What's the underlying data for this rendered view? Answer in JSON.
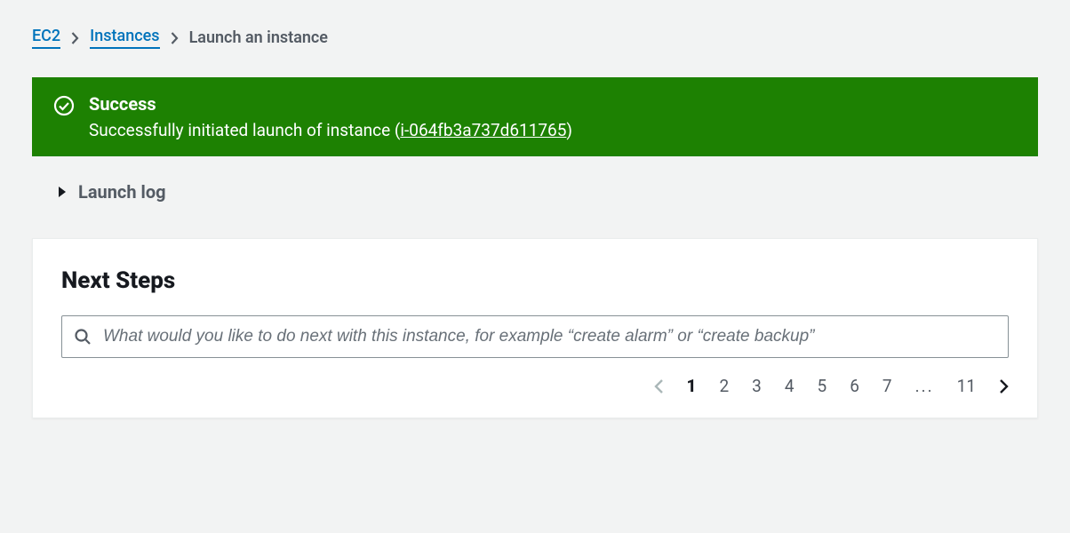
{
  "breadcrumb": {
    "items": [
      {
        "label": "EC2",
        "link": true
      },
      {
        "label": "Instances",
        "link": true
      },
      {
        "label": "Launch an instance",
        "link": false
      }
    ]
  },
  "banner": {
    "title": "Success",
    "message_prefix": "Successfully initiated launch of instance (",
    "instance_id": "i-064fb3a737d611765",
    "message_suffix": ")"
  },
  "launch_log": {
    "label": "Launch log"
  },
  "next_steps": {
    "title": "Next Steps",
    "search_placeholder": "What would you like to do next with this instance, for example “create alarm” or “create backup”"
  },
  "pagination": {
    "pages": [
      "1",
      "2",
      "3",
      "4",
      "5",
      "6",
      "7"
    ],
    "ellipsis": "...",
    "last_page": "11",
    "current": "1"
  }
}
